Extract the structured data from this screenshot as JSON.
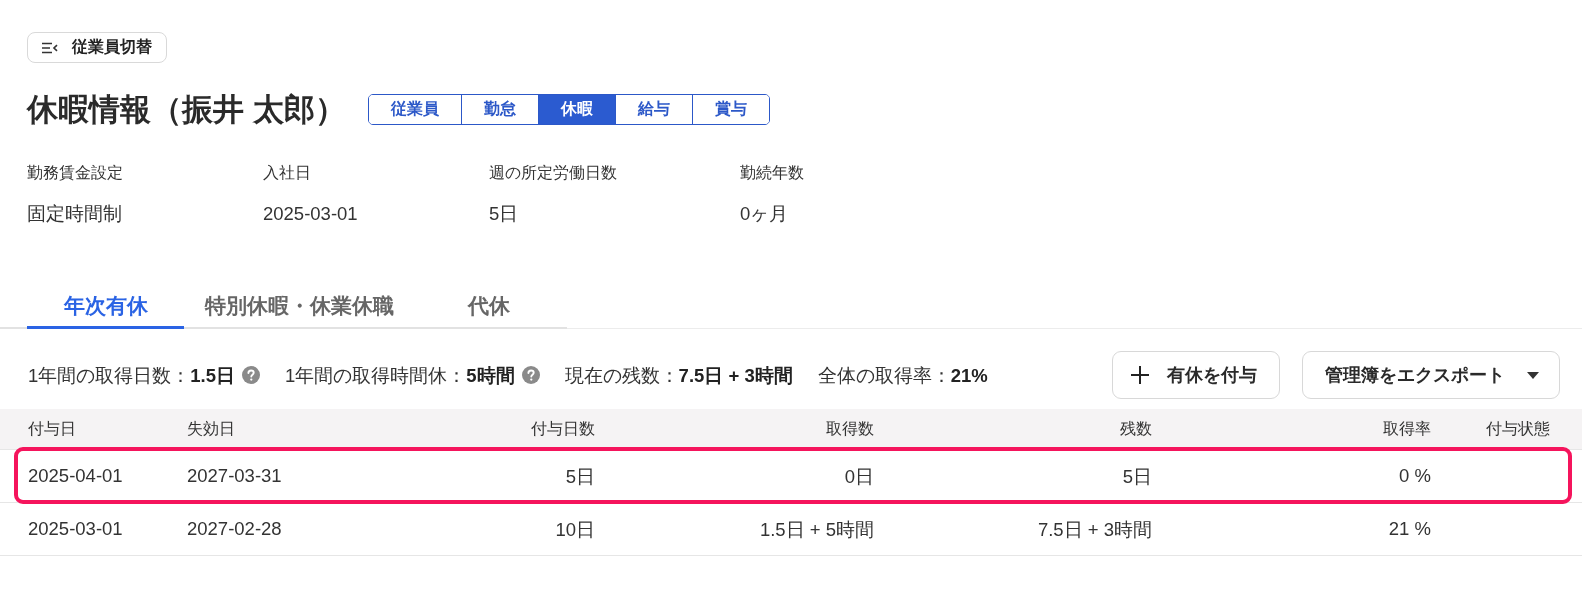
{
  "header": {
    "switch_button": "従業員切替",
    "title": "休暇情報（振井 太郎）",
    "sections": [
      {
        "label": "従業員",
        "selected": false
      },
      {
        "label": "勤怠",
        "selected": false
      },
      {
        "label": "休暇",
        "selected": true
      },
      {
        "label": "給与",
        "selected": false
      },
      {
        "label": "賞与",
        "selected": false
      }
    ]
  },
  "info": [
    {
      "label": "勤務賃金設定",
      "value": "固定時間制"
    },
    {
      "label": "入社日",
      "value": "2025-03-01"
    },
    {
      "label": "週の所定労働日数",
      "value": "5日"
    },
    {
      "label": "勤続年数",
      "value": "0ヶ月"
    }
  ],
  "tabs": [
    {
      "label": "年次有休",
      "selected": true
    },
    {
      "label": "特別休暇・休業休職",
      "selected": false
    },
    {
      "label": "代休",
      "selected": false
    }
  ],
  "summary": [
    {
      "text": "1年間の取得日数：**1.5日**",
      "help": true
    },
    {
      "text": "1年間の取得時間休：**5時間**",
      "help": true
    },
    {
      "text": "現在の残数：**7.5日 + 3時間**",
      "help": false
    },
    {
      "text": "全体の取得率：**21%**",
      "help": false
    }
  ],
  "actions": [
    {
      "kind": "add",
      "label": "有休を付与"
    },
    {
      "kind": "menu",
      "label": "管理簿をエクスポート"
    }
  ],
  "table": {
    "columns": [
      "付与日",
      "失効日",
      "付与日数",
      "取得数",
      "残数",
      "取得率",
      "付与状態"
    ],
    "rows": [
      {
        "cells": [
          "2025-04-01",
          "2027-03-31",
          "5日",
          "0日",
          "5日",
          "0 %"
        ],
        "highlighted": true
      },
      {
        "cells": [
          "2025-03-01",
          "2027-02-28",
          "10日",
          "1.5日 + 5時間",
          "7.5日 + 3時間",
          "21 %"
        ],
        "highlighted": false
      }
    ]
  }
}
